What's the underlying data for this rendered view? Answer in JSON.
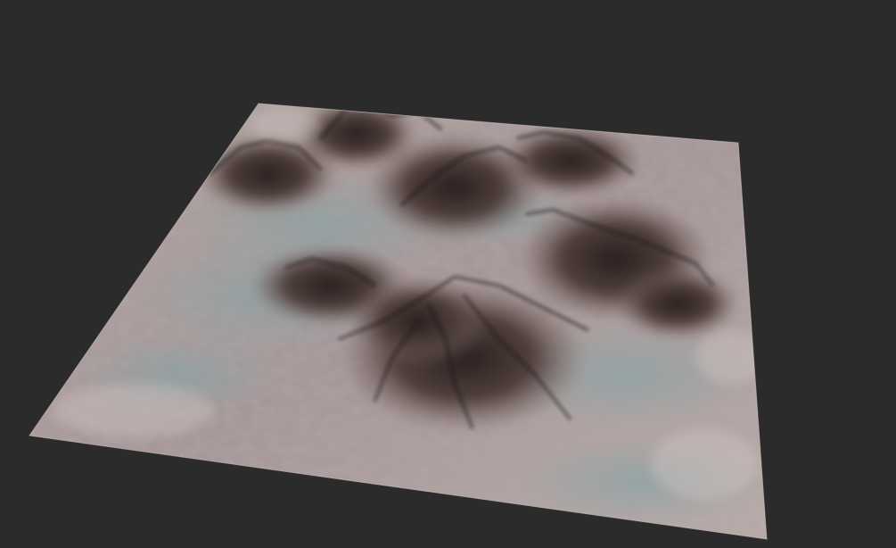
{
  "scene": {
    "background_color": "#2b2b2b",
    "subject": "terrain-heightmap-render",
    "palette": {
      "lowland_light": "#b9aca9",
      "lowland_mid": "#a0918e",
      "riverbed_teal": "#8fa6a6",
      "ridge_mid": "#6e5a56",
      "ridge_dark": "#3f302d",
      "peak_shadow": "#241c1b",
      "highlight": "#d6cbc8"
    }
  }
}
